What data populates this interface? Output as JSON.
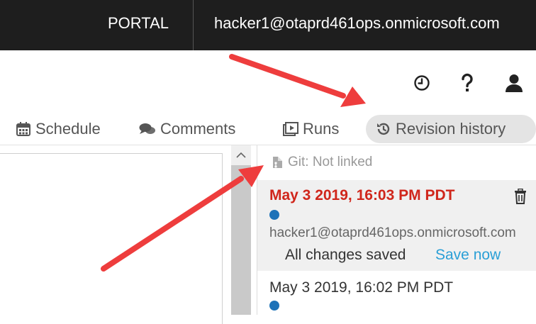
{
  "topbar": {
    "portal_label": "PORTAL",
    "user_email": "hacker1@otaprd461ops.onmicrosoft.com"
  },
  "toolbar": {
    "icons": [
      "clock-icon",
      "help-icon",
      "user-icon"
    ]
  },
  "tabs": [
    {
      "label": "Schedule",
      "icon": "calendar-icon"
    },
    {
      "label": "Comments",
      "icon": "comments-icon"
    },
    {
      "label": "Runs",
      "icon": "runs-icon"
    },
    {
      "label": "Revision history",
      "icon": "history-icon",
      "active": true
    }
  ],
  "revision_panel": {
    "git_status": "Git: Not linked",
    "revisions": [
      {
        "date": "May 3 2019, 16:03 PM PDT",
        "user": "hacker1@otaprd461ops.onmicrosoft.com",
        "status": "All changes saved",
        "action": "Save now",
        "current": true
      },
      {
        "date": "May 3 2019, 16:02 PM PDT",
        "current": false
      }
    ]
  },
  "colors": {
    "topbar_bg": "#1e1e1e",
    "current_revision": "#d0261b",
    "link": "#2a9fd6",
    "dot": "#1d72b8",
    "annotation_arrow": "#ee3d3d"
  }
}
